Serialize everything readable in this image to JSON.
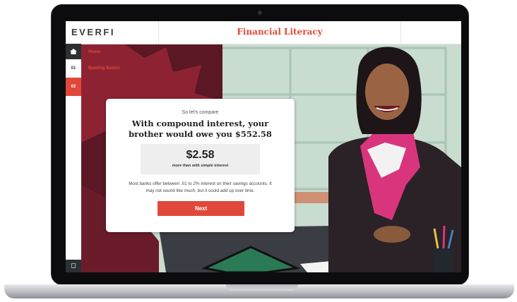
{
  "app": {
    "brand": "EVERFI",
    "course_title": "Financial Literacy"
  },
  "sidebar": {
    "items": [
      {
        "label": "",
        "icon": "home-icon"
      },
      {
        "label": "01"
      },
      {
        "label": "02"
      }
    ],
    "labels": [
      {
        "text": "Home"
      },
      {
        "text": "Banking Basics"
      }
    ]
  },
  "modal": {
    "kicker": "So let's compare",
    "heading": "With compound interest, your brother would owe you $552.58",
    "stat_value": "$2.58",
    "stat_caption": "more than with simple interest",
    "body": "Most banks offer between .01 to 2% interest on their savings accounts. It may not sound like much, but it could add up over time.",
    "next_label": "Next"
  },
  "colors": {
    "accent": "#e0483a",
    "sidebar_dark": "#2c3033",
    "scene_wall": "#c9ddd2"
  }
}
